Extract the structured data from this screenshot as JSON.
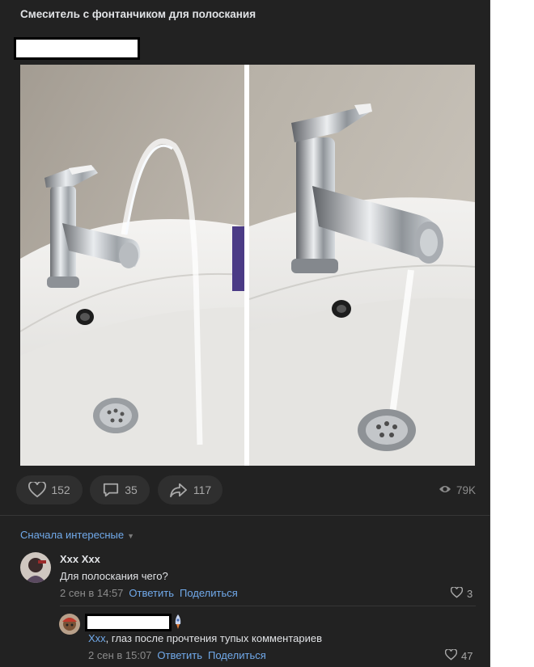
{
  "post": {
    "title": "Смеситель с фонтанчиком для полоскания",
    "actions": {
      "likes": "152",
      "comments": "35",
      "shares": "117",
      "views": "79K"
    }
  },
  "comments": {
    "sort_label": "Сначала интересные",
    "items": [
      {
        "author": "Xxx Xxx",
        "text": "Для полоскания чего?",
        "time": "2 сен в 14:57",
        "reply_label": "Ответить",
        "share_label": "Поделиться",
        "likes": "3"
      },
      {
        "mention": "Xxx",
        "text": ", глаз после прочтения тупых комментариев",
        "time": "2 сен в 15:07",
        "reply_label": "Ответить",
        "share_label": "Поделиться",
        "likes": "47"
      }
    ]
  },
  "icons": {
    "like": "heart-icon",
    "comment": "comment-bubble-icon",
    "share": "share-arrow-icon",
    "views": "eye-icon",
    "sort": "chevron-down-icon",
    "reply_badge": "rocket-icon"
  },
  "colors": {
    "background": "#222222",
    "text": "#e1e3e6",
    "link": "#71aaeb",
    "muted": "#8c8c8c"
  }
}
